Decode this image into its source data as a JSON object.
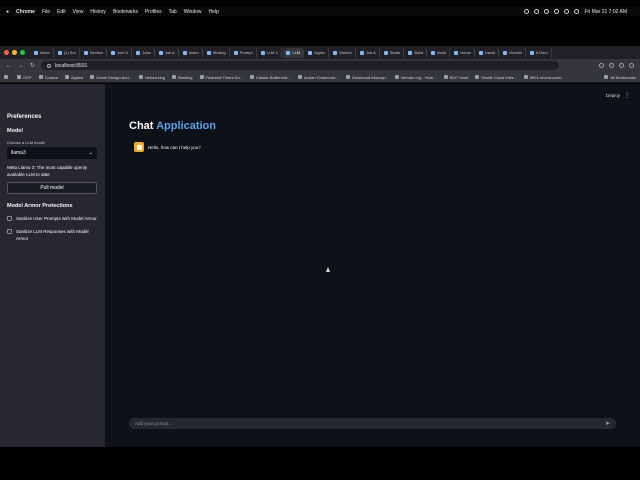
{
  "menubar": {
    "items": [
      "Chrome",
      "File",
      "Edit",
      "View",
      "History",
      "Bookmarks",
      "Profiles",
      "Tab",
      "Window",
      "Help"
    ],
    "clock": "Fri Mar 21  7:02 AM"
  },
  "tabs": [
    "Inbox",
    "(1) Sm",
    "Review",
    "Join D",
    "Jobs",
    "Job A",
    "Inden",
    "Strateg",
    "Prompt",
    "LLM C",
    "LLM",
    "Applic",
    "Stretch",
    "Job A",
    "Strate",
    "Build",
    "Build",
    "Home",
    "David",
    "Gemini",
    "8 Dem"
  ],
  "address": {
    "url": "localhost:8501"
  },
  "bookmarks": [
    "GCP",
    "Comics",
    "Apples",
    "Game Design And...",
    "Networking",
    "Banking",
    "Financial Times Da...",
    "Classic Buttermilk...",
    "Audan Communic...",
    "Download Inkscap...",
    "blender.org - Hom...",
    "SDC Vault",
    "Oracle Cloud Infra...",
    "8901-recent-archi..."
  ],
  "bookmarks_all": "All Bookmarks",
  "sidebar": {
    "heading": "Preferences",
    "model_heading": "Model",
    "select_label": "Choose a LLM model",
    "select_value": "llama3",
    "description": "Meta Llama 3: The most capable openly available LLM to date",
    "pull_button": "Pull model",
    "armor_heading": "Model Armor Protections",
    "checkboxes": [
      {
        "label": "Sanitize User Prompts with Model Armor",
        "checked": false
      },
      {
        "label": "Sanitize LLM Responses with Model Armor",
        "checked": false
      }
    ]
  },
  "header": {
    "deploy": "Deploy",
    "menu": "⋮"
  },
  "main": {
    "title_word1": "Chat",
    "title_word2": "Application",
    "assistant_message": "Hello, how can I help you?",
    "prompt_placeholder": "Add your prompt...",
    "send_icon": "➤"
  },
  "colors": {
    "accent": "#5aa0e6",
    "avatar": "#f5a623",
    "sidebar": "#262730",
    "background": "#0e1117"
  }
}
